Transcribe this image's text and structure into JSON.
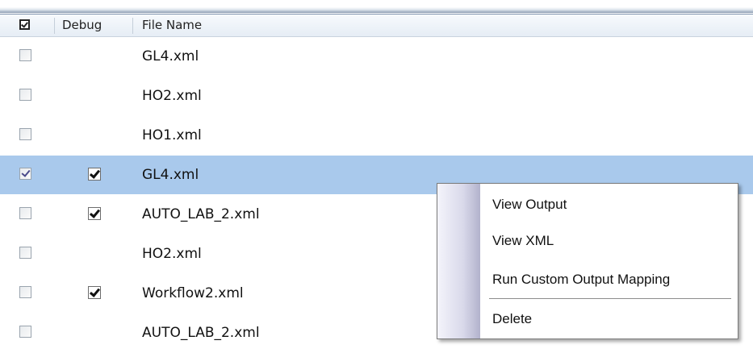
{
  "columns": {
    "debug": "Debug",
    "file_name": "File Name"
  },
  "rows": [
    {
      "file": "GL4.xml",
      "selected": false,
      "debug": false
    },
    {
      "file": "HO2.xml",
      "selected": false,
      "debug": false
    },
    {
      "file": "HO1.xml",
      "selected": false,
      "debug": false
    },
    {
      "file": "GL4.xml",
      "selected": true,
      "debug": true
    },
    {
      "file": "AUTO_LAB_2.xml",
      "selected": false,
      "debug": true
    },
    {
      "file": "HO2.xml",
      "selected": false,
      "debug": false
    },
    {
      "file": "Workflow2.xml",
      "selected": false,
      "debug": true
    },
    {
      "file": "AUTO_LAB_2.xml",
      "selected": false,
      "debug": false
    }
  ],
  "context_menu": {
    "items": [
      "View Output",
      "View XML",
      "Run Custom Output Mapping",
      "Delete"
    ]
  },
  "colors": {
    "selection": "#a9c9ec",
    "header_border": "#7f93ad"
  },
  "icons": {
    "header_checkbox": "checkbox-checked-icon",
    "debug_check": "checkmark-icon"
  }
}
